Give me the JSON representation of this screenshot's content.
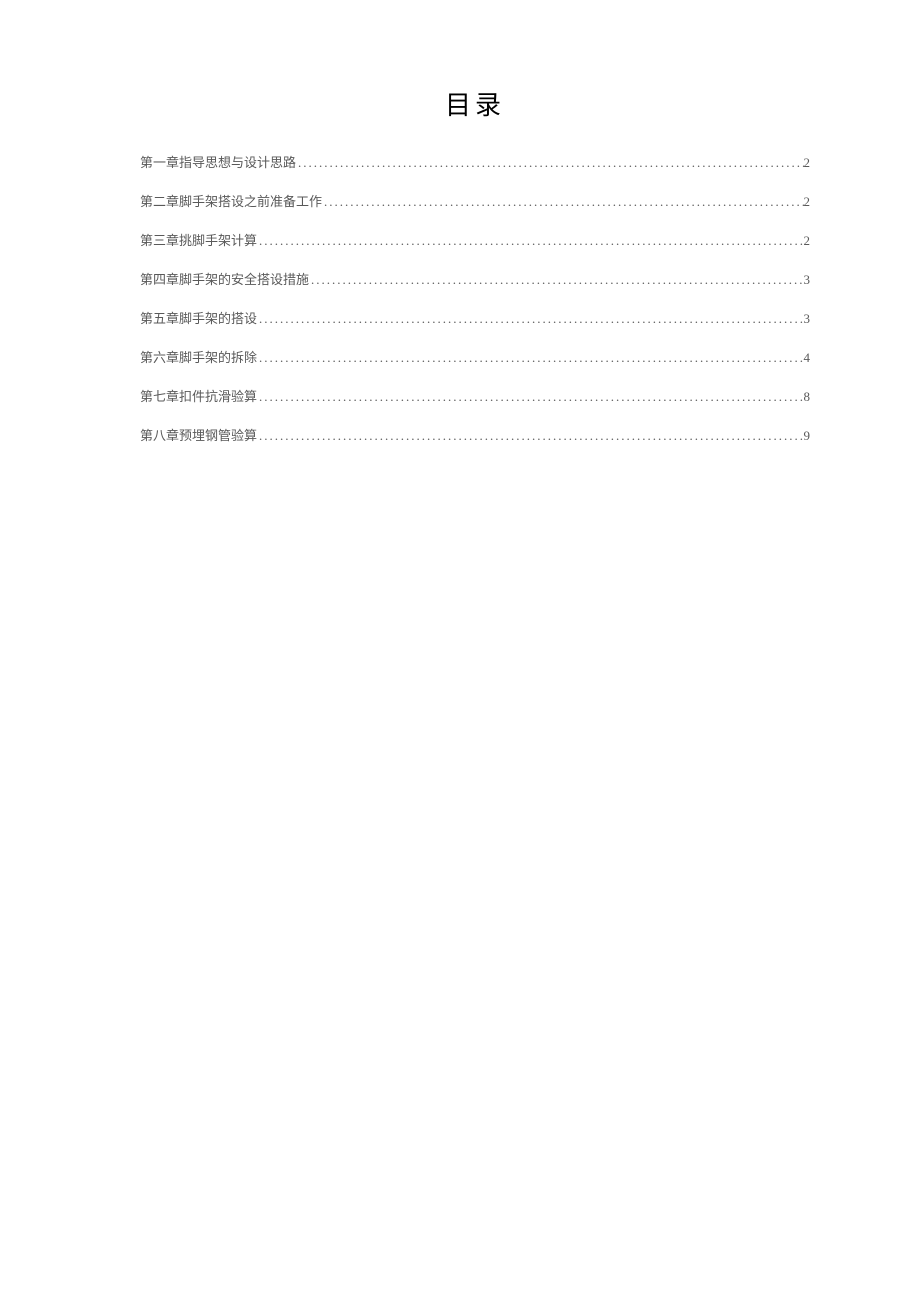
{
  "title": "目录",
  "toc": [
    {
      "label": "第一章指导思想与设计思路",
      "page": "2"
    },
    {
      "label": "第二章脚手架搭设之前准备工作",
      "page": "2"
    },
    {
      "label": "第三章挑脚手架计算",
      "page": "2"
    },
    {
      "label": "第四章脚手架的安全搭设措施",
      "page": "3"
    },
    {
      "label": "第五章脚手架的搭设",
      "page": "3"
    },
    {
      "label": "第六章脚手架的拆除",
      "page": "4"
    },
    {
      "label": "第七章扣件抗滑验算",
      "page": "8"
    },
    {
      "label": "第八章预埋钢管验算",
      "page": "9"
    }
  ]
}
